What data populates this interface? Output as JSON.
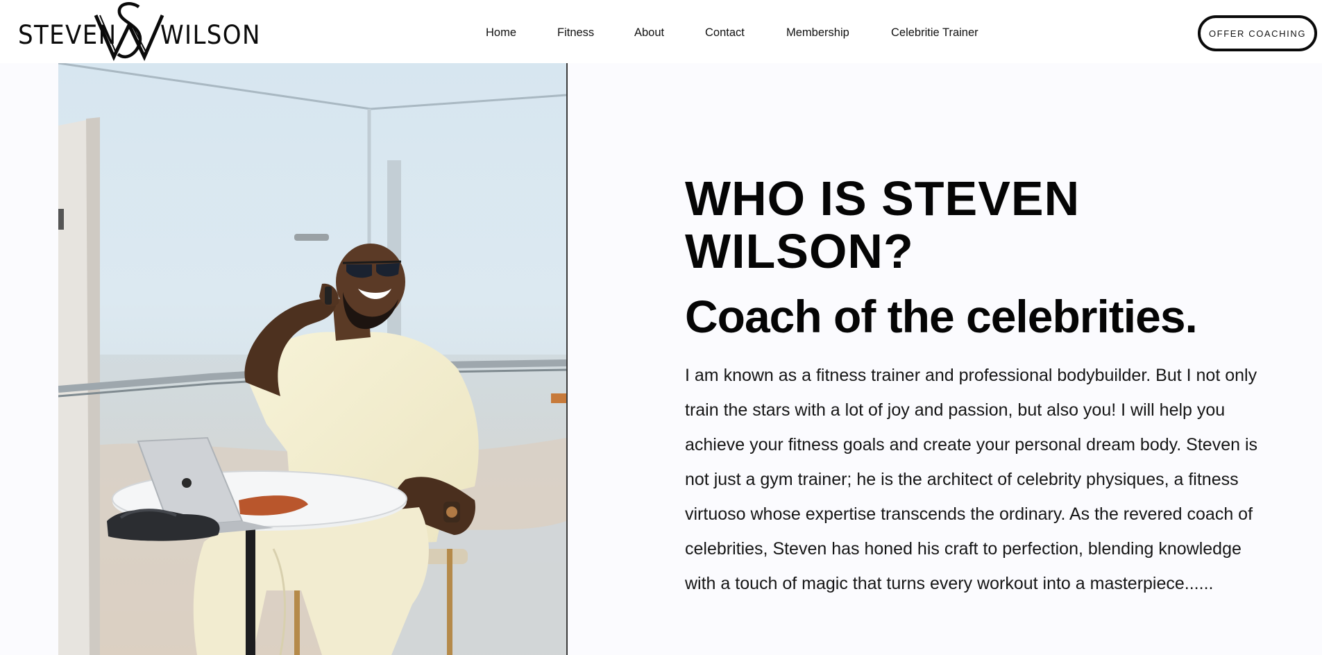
{
  "header": {
    "logo": {
      "left_word": "STEVEN",
      "right_word": "WILSON"
    },
    "nav": [
      {
        "label": "Home"
      },
      {
        "label": "Fitness"
      },
      {
        "label": "About"
      },
      {
        "label": "Contact"
      },
      {
        "label": "Membership"
      },
      {
        "label": "Celebritie Trainer"
      }
    ],
    "cta_label": "OFFER COACHING"
  },
  "hero": {
    "image_description": "coach-laughing-on-phone-at-rooftop-table",
    "title_line1": "WHO IS STEVEN",
    "title_line2": "WILSON?",
    "subtitle": "Coach of the celebrities.",
    "body": "I am known as a fitness trainer and professional bodybuilder. But I not only train the stars with a lot of joy and passion, but also you! I will help you achieve your fitness goals and create your personal dream body. Steven is not just a gym trainer; he is the architect of celebrity physiques, a fitness virtuoso whose expertise transcends the ordinary. As the revered coach of celebrities, Steven has honed his craft to perfection, blending knowledge with a touch of magic that turns every workout into a masterpiece......"
  },
  "colors": {
    "background": "#fbfbfe",
    "header_bg": "#ffffff",
    "text": "#0a0a0a",
    "outfit_cream": "#f4efcf"
  }
}
